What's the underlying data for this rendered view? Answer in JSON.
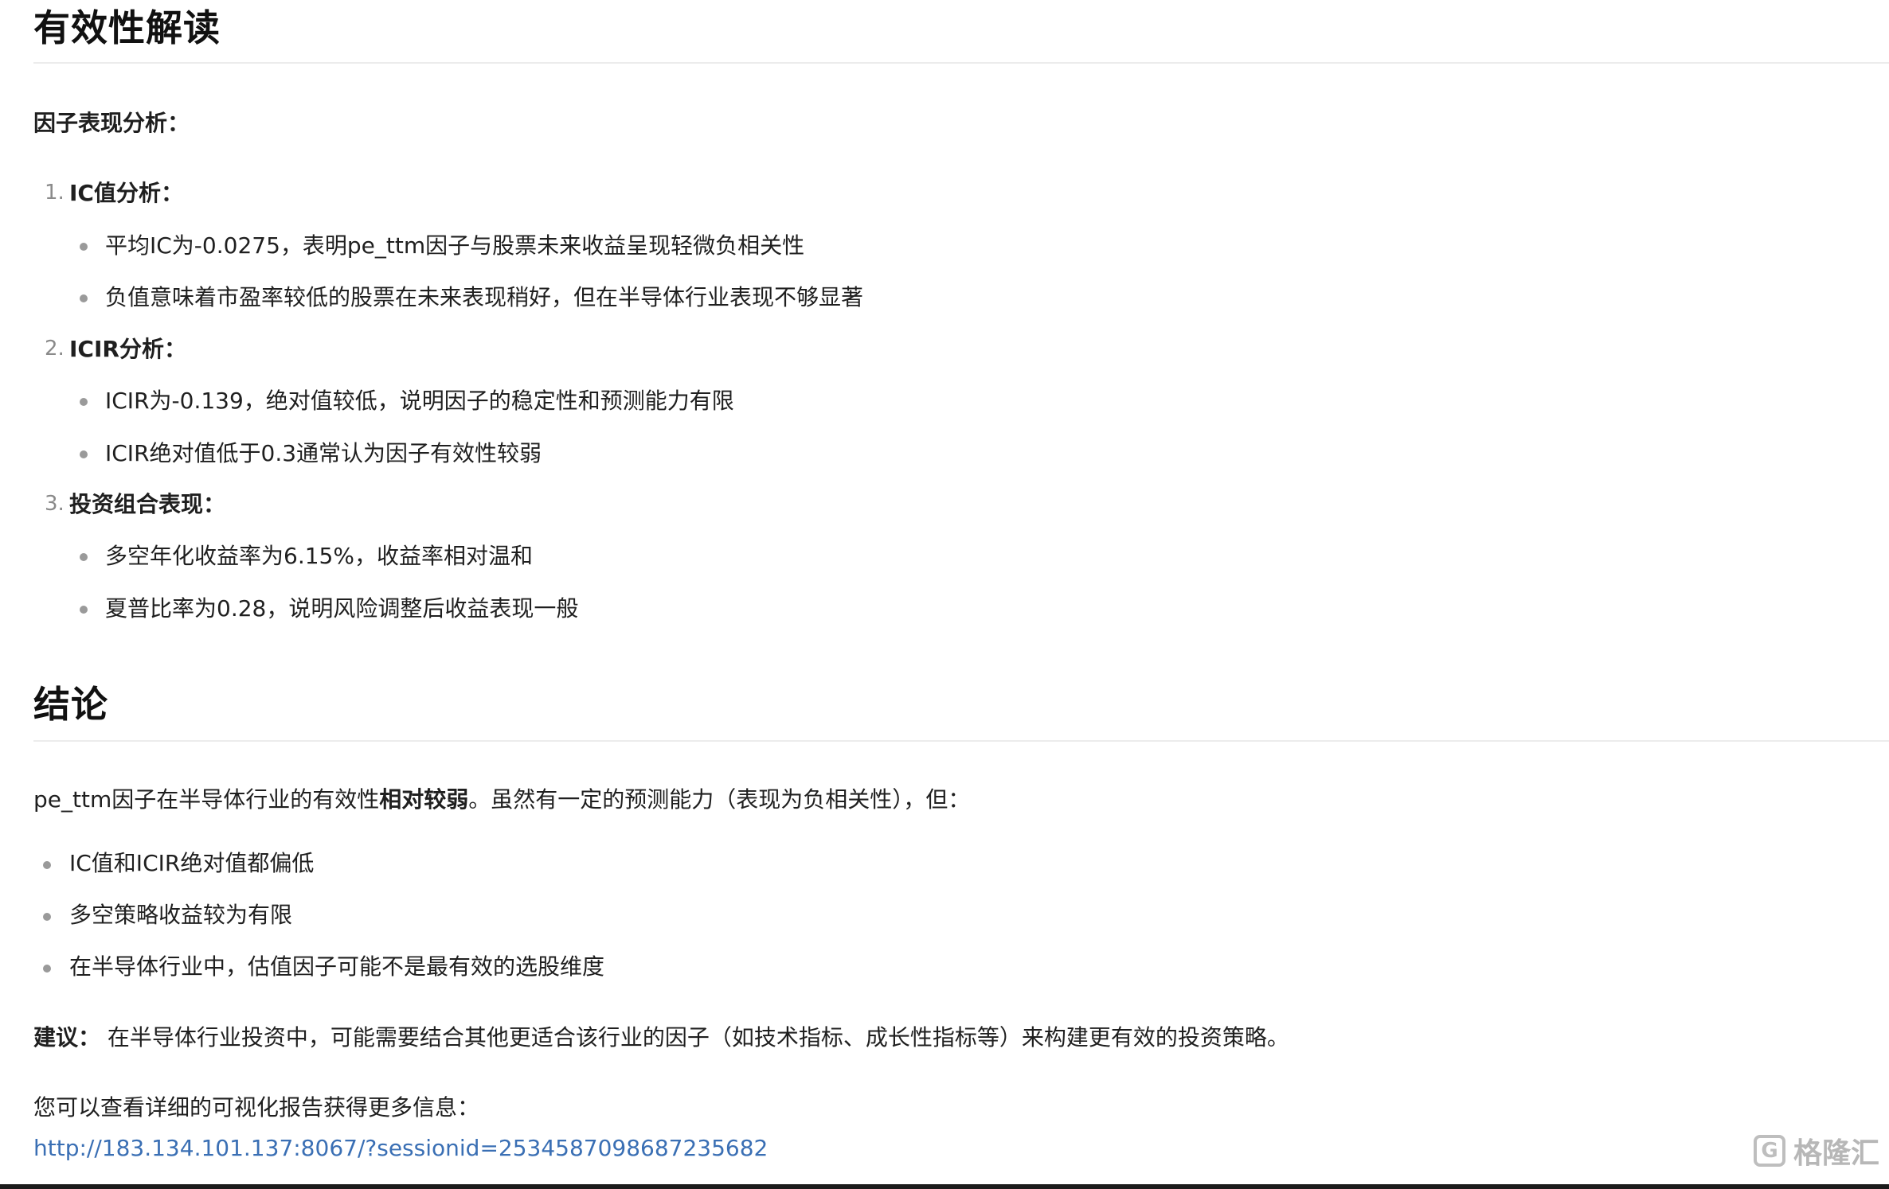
{
  "section1": {
    "heading": "有效性解读",
    "intro_bold": "因子表现分析：",
    "items": [
      {
        "num": "1.",
        "title": "IC值分析：",
        "bullets": [
          "平均IC为-0.0275，表明pe_ttm因子与股票未来收益呈现轻微负相关性",
          "负值意味着市盈率较低的股票在未来表现稍好，但在半导体行业表现不够显著"
        ]
      },
      {
        "num": "2.",
        "title": "ICIR分析：",
        "bullets": [
          "ICIR为-0.139，绝对值较低，说明因子的稳定性和预测能力有限",
          "ICIR绝对值低于0.3通常认为因子有效性较弱"
        ]
      },
      {
        "num": "3.",
        "title": "投资组合表现：",
        "bullets": [
          "多空年化收益率为6.15%，收益率相对温和",
          "夏普比率为0.28，说明风险调整后收益表现一般"
        ]
      }
    ]
  },
  "section2": {
    "heading": "结论",
    "summary_pre": "pe_ttm因子在半导体行业的有效性",
    "summary_bold": "相对较弱",
    "summary_post": "。虽然有一定的预测能力（表现为负相关性），但：",
    "bullets": [
      "IC值和ICIR绝对值都偏低",
      "多空策略收益较为有限",
      "在半导体行业中，估值因子可能不是最有效的选股维度"
    ],
    "suggestion_label": "建议：",
    "suggestion_text": " 在半导体行业投资中，可能需要结合其他更适合该行业的因子（如技术指标、成长性指标等）来构建更有效的投资策略。",
    "report_intro": "您可以查看详细的可视化报告获得更多信息：",
    "report_link": "http://183.134.101.137:8067/?sessionid=2534587098687235682"
  },
  "watermark": {
    "text": "格隆汇",
    "logo_glyph": "G"
  }
}
